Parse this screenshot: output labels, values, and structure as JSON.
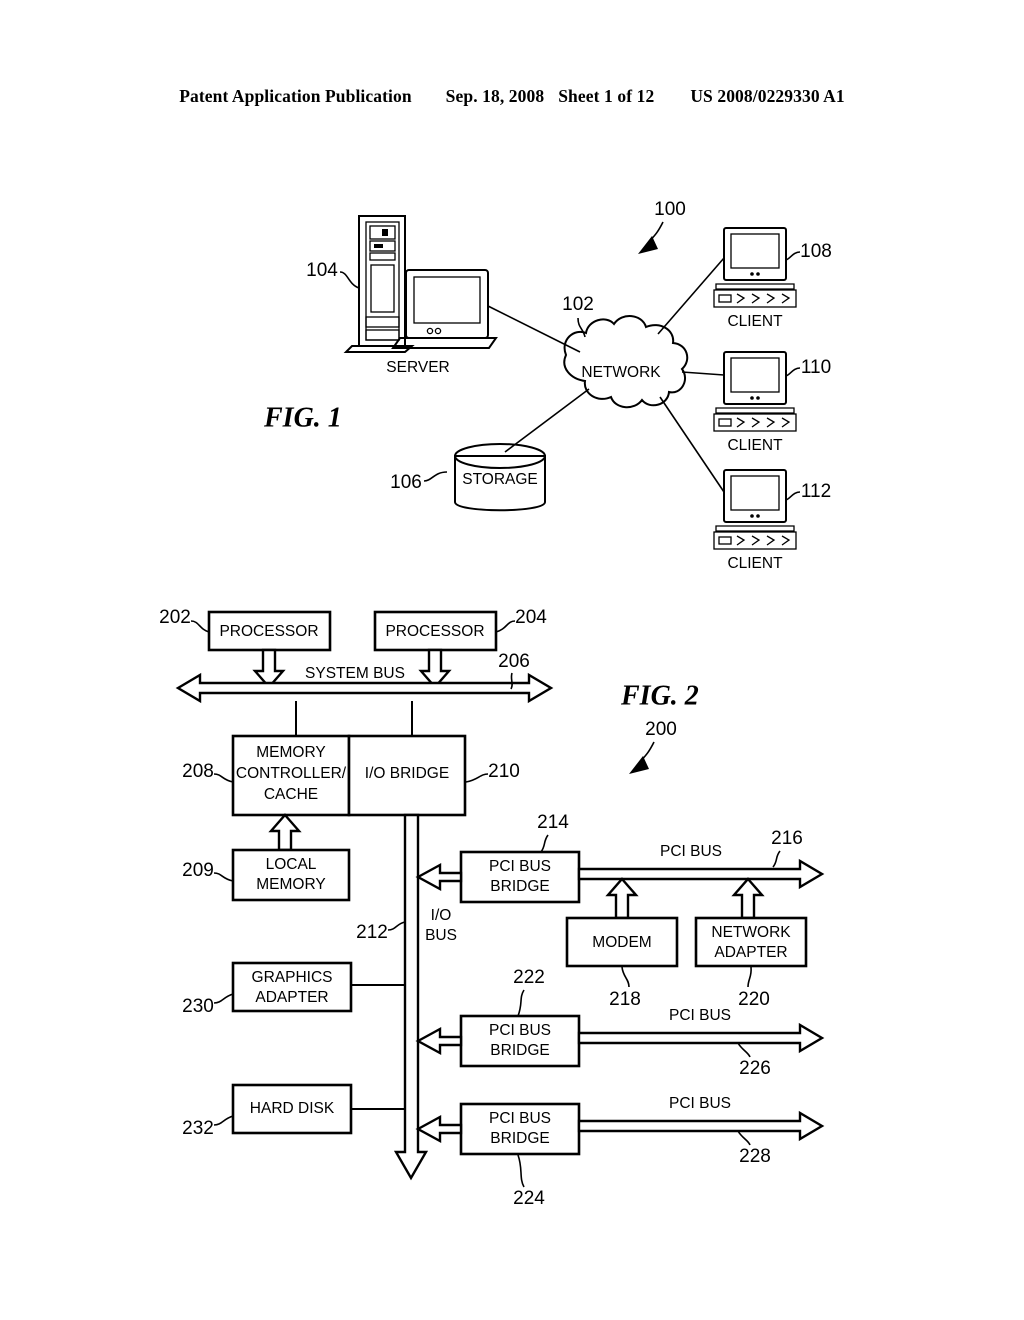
{
  "document": {
    "header": {
      "publication": "Patent Application Publication",
      "date": "Sep. 18, 2008",
      "sheet": "Sheet 1 of 12",
      "number": "US 2008/0229330 A1"
    }
  },
  "figures": [
    {
      "id": "fig1",
      "label": "FIG. 1",
      "system_ref": "100",
      "nodes": {
        "server": {
          "label": "SERVER",
          "ref": "104",
          "icon": "server-tower-icon"
        },
        "network": {
          "label": "NETWORK",
          "ref": "102",
          "icon": "cloud-icon"
        },
        "storage": {
          "label": "STORAGE",
          "ref": "106",
          "icon": "cylinder-icon"
        },
        "client1": {
          "label": "CLIENT",
          "ref": "108",
          "icon": "client-workstation-icon"
        },
        "client2": {
          "label": "CLIENT",
          "ref": "110",
          "icon": "client-workstation-icon"
        },
        "client3": {
          "label": "CLIENT",
          "ref": "112",
          "icon": "client-workstation-icon"
        }
      }
    },
    {
      "id": "fig2",
      "label": "FIG. 2",
      "system_ref": "200",
      "blocks": {
        "processor1": {
          "label": "PROCESSOR",
          "ref": "202"
        },
        "processor2": {
          "label": "PROCESSOR",
          "ref": "204"
        },
        "system_bus": {
          "label": "SYSTEM BUS",
          "ref": "206"
        },
        "memctl": {
          "label": "MEMORY CONTROLLER/ CACHE",
          "line1": "MEMORY",
          "line2": "CONTROLLER/",
          "line3": "CACHE",
          "ref": "208"
        },
        "local_mem": {
          "line1": "LOCAL",
          "line2": "MEMORY",
          "ref": "209"
        },
        "io_bridge": {
          "label": "I/O BRIDGE",
          "ref": "210"
        },
        "io_bus": {
          "line1": "I/O",
          "line2": "BUS",
          "ref": "212"
        },
        "pci_bridge1": {
          "line1": "PCI BUS",
          "line2": "BRIDGE",
          "ref": "214"
        },
        "pci_bus1": {
          "label": "PCI BUS",
          "ref": "216"
        },
        "modem": {
          "label": "MODEM",
          "ref": "218"
        },
        "net_adapter": {
          "line1": "NETWORK",
          "line2": "ADAPTER",
          "ref": "220"
        },
        "pci_bridge2": {
          "line1": "PCI BUS",
          "line2": "BRIDGE",
          "ref": "222"
        },
        "pci_bus2": {
          "label": "PCI BUS",
          "ref": "226"
        },
        "pci_bridge3": {
          "line1": "PCI BUS",
          "line2": "BRIDGE",
          "ref": "224"
        },
        "pci_bus3": {
          "label": "PCI BUS",
          "ref": "228"
        },
        "graphics": {
          "line1": "GRAPHICS",
          "line2": "ADAPTER",
          "ref": "230"
        },
        "hard_disk": {
          "label": "HARD DISK",
          "ref": "232"
        }
      }
    }
  ],
  "colors": {
    "ink": "#000000",
    "paper": "#ffffff"
  }
}
